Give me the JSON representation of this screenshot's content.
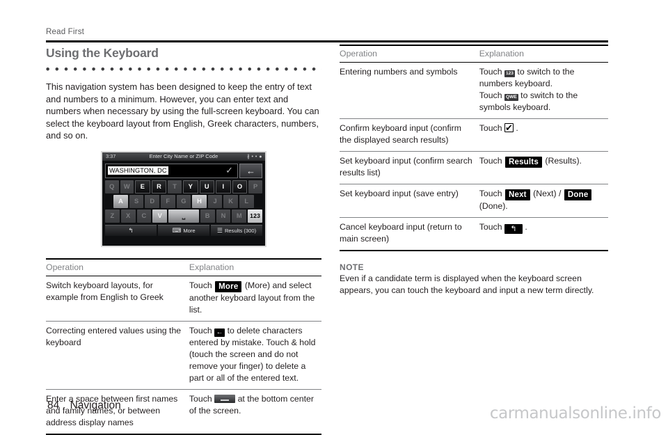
{
  "page": {
    "running_head": "Read First",
    "folio_number": "84",
    "folio_label": "Navigation",
    "watermark": "carmanualsonline.info"
  },
  "section": {
    "title": "Using the Keyboard",
    "intro": "This navigation system has been designed to keep the entry of text and numbers to a minimum. However, you can enter text and numbers when necessary by using the full-screen keyboard. You can select the keyboard layout from English, Greek characters, numbers, and so on."
  },
  "device": {
    "clock": "3:37",
    "title": "Enter City Name or ZIP Code",
    "status_icons": "∦ • • ●",
    "input_value": "WASHINGTON, DC",
    "confirm_icon": "check-icon",
    "backspace_icon": "backspace-arrow-icon",
    "keyboard_rows": [
      [
        {
          "label": "Q",
          "state": "off"
        },
        {
          "label": "W",
          "state": "off"
        },
        {
          "label": "E",
          "state": "on"
        },
        {
          "label": "R",
          "state": "on"
        },
        {
          "label": "T",
          "state": "off"
        },
        {
          "label": "Y",
          "state": "on"
        },
        {
          "label": "U",
          "state": "on"
        },
        {
          "label": "I",
          "state": "on"
        },
        {
          "label": "O",
          "state": "on"
        },
        {
          "label": "P",
          "state": "off"
        }
      ],
      [
        {
          "label": "A",
          "state": "lit"
        },
        {
          "label": "S",
          "state": "off"
        },
        {
          "label": "D",
          "state": "off"
        },
        {
          "label": "F",
          "state": "off"
        },
        {
          "label": "G",
          "state": "off"
        },
        {
          "label": "H",
          "state": "lit"
        },
        {
          "label": "J",
          "state": "off"
        },
        {
          "label": "K",
          "state": "off"
        },
        {
          "label": "L",
          "state": "off"
        }
      ],
      [
        {
          "label": "Z",
          "state": "off"
        },
        {
          "label": "X",
          "state": "off"
        },
        {
          "label": "C",
          "state": "off"
        },
        {
          "label": "V",
          "state": "lit"
        },
        {
          "label": "",
          "state": "space"
        },
        {
          "label": "B",
          "state": "off"
        },
        {
          "label": "N",
          "state": "off"
        },
        {
          "label": "M",
          "state": "off"
        },
        {
          "label": "123",
          "state": "num"
        }
      ]
    ],
    "bottom_buttons": [
      {
        "glyph": "↰",
        "label": "",
        "name": "back-button"
      },
      {
        "glyph": "⌨",
        "label": "More",
        "name": "more-button"
      },
      {
        "glyph": "☰",
        "label": "Results (300)",
        "name": "results-button"
      }
    ]
  },
  "table_left": {
    "headers": [
      "Operation",
      "Explanation"
    ],
    "rows": [
      {
        "operation": "Switch keyboard layouts, for example from English to Greek",
        "explanation_pre": "Touch",
        "badge": "More",
        "badge_type": "text",
        "explanation_post": "(More) and select another keyboard layout from the list."
      },
      {
        "operation": "Correcting entered values using the keyboard",
        "explanation_pre": "Touch",
        "badge": "←",
        "badge_type": "arrow",
        "explanation_post": "to delete characters entered by mistake. Touch & hold (touch the screen and do not remove your finger) to delete a part or all of the entered text."
      },
      {
        "operation": "Enter a space between first names and family names, or between address display names",
        "explanation_pre": "Touch",
        "badge": "",
        "badge_type": "space",
        "explanation_post": "at the bottom center of the screen."
      }
    ]
  },
  "table_right": {
    "headers": [
      "Operation",
      "Explanation"
    ],
    "rows": [
      {
        "operation": "Entering numbers and symbols",
        "line1_pre": "Touch",
        "line1_badge": "123",
        "line1_post": "to switch to the numbers keyboard.",
        "line2_pre": "Touch",
        "line2_badge": "QWE",
        "line2_post": "to switch to the symbols keyboard."
      },
      {
        "operation": "Confirm keyboard input (confirm the displayed search results)",
        "line1_pre": "Touch",
        "line1_badge": "check",
        "line1_post": "."
      },
      {
        "operation": "Set keyboard input (confirm search results list)",
        "line1_pre": "Touch",
        "line1_badge": "Results",
        "line1_post": "(Results)."
      },
      {
        "operation": "Set keyboard input (save entry)",
        "line1_pre": "Touch",
        "line1_badge": "Next",
        "line1_mid": "(Next) /",
        "line1_badge2": "Done",
        "line1_post": "(Done)."
      },
      {
        "operation": "Cancel keyboard input (return to main screen)",
        "line1_pre": "Touch",
        "line1_badge": "↰",
        "line1_post": "."
      }
    ]
  },
  "note": {
    "title": "NOTE",
    "body": "Even if a candidate term is displayed when the keyboard screen appears, you can touch the keyboard and input a new term directly."
  }
}
